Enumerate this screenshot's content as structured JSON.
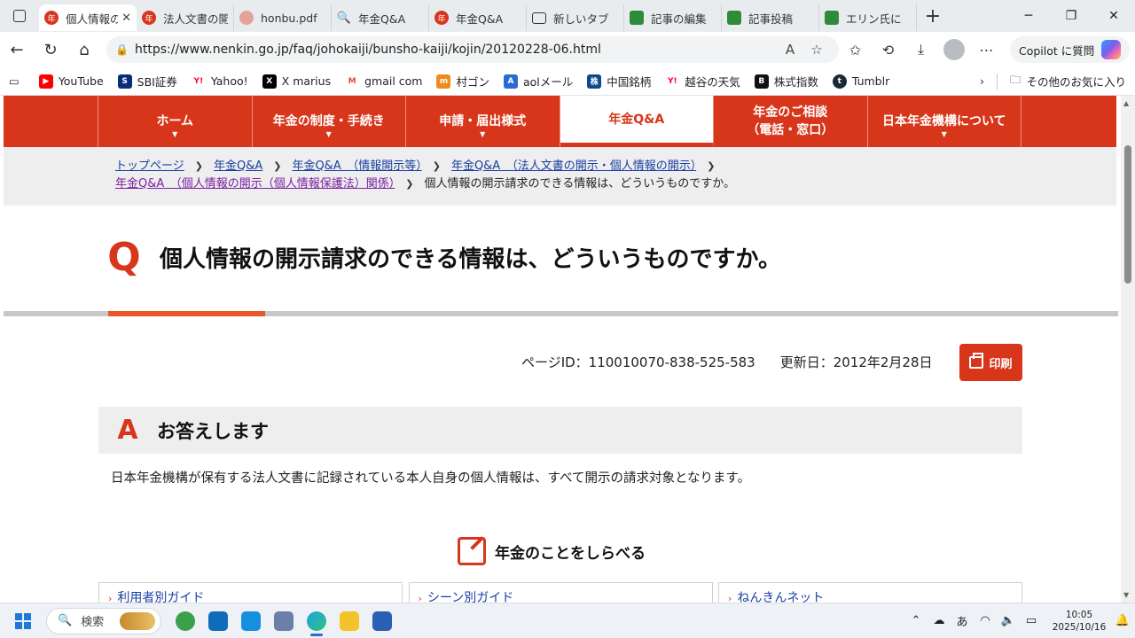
{
  "browser": {
    "tabs": [
      {
        "title": "個人情報の開示請求",
        "icon": "nenkin-logo",
        "active": true
      },
      {
        "title": "法人文書の開示",
        "icon": "nenkin-logo"
      },
      {
        "title": "honbu.pdf",
        "icon": "honbu-logo"
      },
      {
        "title": "年金Q&A",
        "icon": "search-icon"
      },
      {
        "title": "年金Q&A",
        "icon": "nenkin-logo"
      },
      {
        "title": "新しいタブ",
        "icon": "newtab-icon"
      },
      {
        "title": "記事の編集",
        "icon": "frog-logo"
      },
      {
        "title": "記事投稿",
        "icon": "frog-logo"
      },
      {
        "title": "エリン氏に",
        "icon": "frog-logo"
      }
    ],
    "url": "https://www.nenkin.go.jp/faq/johokaiji/bunsho-kaiji/kojin/20120228-06.html",
    "copilot_label": "Copilot に質問",
    "bookmarks": [
      {
        "label": "YouTube",
        "icon": "youtube-icon",
        "color": "#ff0000"
      },
      {
        "label": "SBI証券",
        "icon": "sbi-icon",
        "color": "#0a2d7a"
      },
      {
        "label": "Yahoo!",
        "icon": "yahoo-icon",
        "color": "#ff0033"
      },
      {
        "label": "X marius",
        "icon": "x-icon",
        "color": "#000000"
      },
      {
        "label": "gmail com",
        "icon": "gmail-icon",
        "color": "#ea4335"
      },
      {
        "label": "村ゴン",
        "icon": "m-icon",
        "color": "#f08a1c"
      },
      {
        "label": "aolメール",
        "icon": "aol-icon",
        "color": "#2a6bd1"
      },
      {
        "label": "中国銘柄",
        "icon": "chart-icon",
        "color": "#0a4a8a"
      },
      {
        "label": "越谷の天気",
        "icon": "yahoo-icon",
        "color": "#ff0033"
      },
      {
        "label": "株式指数",
        "icon": "b-icon",
        "color": "#111111"
      },
      {
        "label": "Tumblr",
        "icon": "tumblr-icon",
        "color": "#1b2836"
      }
    ],
    "other_favorites": "その他のお気に入り"
  },
  "site": {
    "nav": [
      {
        "label": "ホーム",
        "current": false
      },
      {
        "label": "年金の制度・手続き",
        "current": false
      },
      {
        "label": "申請・届出様式",
        "current": false
      },
      {
        "label": "年金Q&A",
        "current": true
      },
      {
        "label": "年金のご相談\n（電話・窓口）",
        "current": false
      },
      {
        "label": "日本年金機構について",
        "current": false
      }
    ],
    "breadcrumbs": [
      "トップページ",
      "年金Q&A",
      "年金Q&A　（情報開示等）",
      "年金Q&A　（法人文書の開示・個人情報の開示）",
      "年金Q&A　（個人情報の開示（個人情報保護法）関係）"
    ],
    "breadcrumb_current": "個人情報の開示請求のできる情報は、どういうものですか。",
    "q_mark": "Q",
    "question": "個人情報の開示請求のできる情報は、どういうものですか。",
    "page_id": "ページID：110010070-838-525-583",
    "updated": "更新日：2012年2月28日",
    "print_label": "印刷",
    "a_mark": "A",
    "answer_heading": "お答えします",
    "answer_body": "日本年金機構が保有する法人文書に記録されている本人自身の個人情報は、すべて開示の請求対象となります。",
    "section_title": "年金のことをしらべる",
    "cards": [
      "利用者別ガイド",
      "シーン別ガイド",
      "ねんきんネット"
    ],
    "accent_color": "#d8361b"
  },
  "taskbar": {
    "search_placeholder": "検索",
    "ime": "あ",
    "time": "10:05",
    "date": "2025/10/16"
  }
}
